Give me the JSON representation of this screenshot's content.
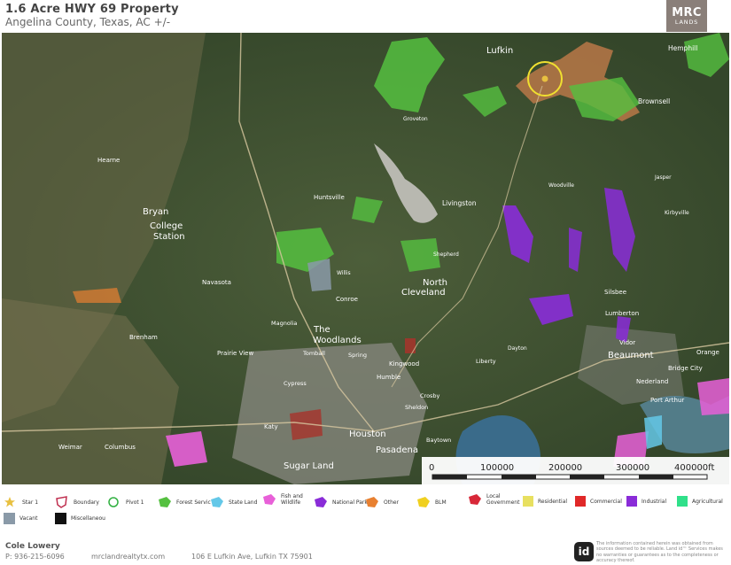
{
  "header": {
    "title": "1.6 Acre HWY 69 Property",
    "subtitle": "Angelina County, Texas,  AC +/-",
    "logo_line1": "MRC",
    "logo_line2": "LANDS"
  },
  "map": {
    "city_labels": [
      {
        "text": "Lufkin"
      },
      {
        "text": "Hemphill"
      },
      {
        "text": "Brownsell"
      },
      {
        "text": "Bryan"
      },
      {
        "text": "College"
      },
      {
        "text": "Station"
      },
      {
        "text": "Huntsville"
      },
      {
        "text": "Livingston"
      },
      {
        "text": "North"
      },
      {
        "text": "Cleveland"
      },
      {
        "text": "Navasota"
      },
      {
        "text": "Conroe"
      },
      {
        "text": "The"
      },
      {
        "text": "Woodlands"
      },
      {
        "text": "Beaumont"
      },
      {
        "text": "Lumberton"
      },
      {
        "text": "Silsbee"
      },
      {
        "text": "Brenham"
      },
      {
        "text": "Houston"
      },
      {
        "text": "Pasadena"
      },
      {
        "text": "Sugar Land"
      },
      {
        "text": "Katy"
      },
      {
        "text": "Humble"
      },
      {
        "text": "Kingwood"
      },
      {
        "text": "Orange"
      },
      {
        "text": "Port Arthur"
      },
      {
        "text": "Bridge City"
      },
      {
        "text": "Nederland"
      },
      {
        "text": "Vidor"
      },
      {
        "text": "Hearne"
      },
      {
        "text": "Prairie View"
      },
      {
        "text": "Tomball"
      },
      {
        "text": "Spring"
      },
      {
        "text": "Cypress"
      },
      {
        "text": "Baytown"
      },
      {
        "text": "Crosby"
      },
      {
        "text": "Weimar"
      },
      {
        "text": "Columbus"
      },
      {
        "text": "Liberty"
      },
      {
        "text": "Dayton"
      },
      {
        "text": "Magnolia"
      },
      {
        "text": "Sheldon"
      },
      {
        "text": "Willis"
      },
      {
        "text": "Shepherd"
      },
      {
        "text": "Groveton"
      },
      {
        "text": "Woodville"
      },
      {
        "text": "Jasper"
      },
      {
        "text": "Kirbyville"
      }
    ],
    "scale": {
      "labels": [
        "0",
        "100000",
        "200000",
        "300000",
        "400000ft"
      ]
    },
    "colors": {
      "forest_service": "#55c040",
      "state_land": "#64c8e8",
      "fish_wildlife": "#e860d8",
      "national_park": "#8a2cd8",
      "other": "#e88030",
      "local_government": "#d82838",
      "residential": "#e8e060",
      "commercial": "#e02828",
      "industrial": "#8a2cd8",
      "agricultural": "#30e08a",
      "vacant": "#8a9aa8",
      "miscellaneous": "#111111",
      "pivot": "#f0e030",
      "star": "#e8c040"
    }
  },
  "legend": {
    "items": [
      {
        "label": "Star 1",
        "icon": "star-icon"
      },
      {
        "label": "Boundary",
        "icon": "boundary-icon"
      },
      {
        "label": "Pivot 1",
        "icon": "pivot-circle-icon"
      },
      {
        "label": "Forest Servic",
        "icon": "forest-service-swatch"
      },
      {
        "label": "State Land",
        "icon": "state-land-swatch"
      },
      {
        "label": "Fish and Wildlife",
        "icon": "fish-wildlife-swatch"
      },
      {
        "label": "National Park",
        "icon": "national-park-swatch"
      },
      {
        "label": "Other",
        "icon": "other-swatch"
      },
      {
        "label": "BLM",
        "icon": "blm-swatch"
      },
      {
        "label": "Local Government",
        "icon": "local-government-swatch"
      },
      {
        "label": "Residential",
        "icon": "residential-swatch"
      },
      {
        "label": "Commercial",
        "icon": "commercial-swatch"
      },
      {
        "label": "Industrial",
        "icon": "industrial-swatch"
      },
      {
        "label": "Agricultural",
        "icon": "agricultural-swatch"
      },
      {
        "label": "Vacant",
        "icon": "vacant-swatch"
      },
      {
        "label": "Miscellaneou",
        "icon": "miscellaneous-swatch"
      }
    ]
  },
  "footer": {
    "agent_name": "Cole Lowery",
    "phone": "P: 936-215-6096",
    "website": "mrclandrealtytx.com",
    "address": "106 E Lufkin Ave, Lufkin TX 75901",
    "badge": "id",
    "disclaimer": "The information contained herein was obtained from sources deemed to be reliable. Land id™ Services makes no warranties or guarantees as to the completeness or accuracy thereof."
  }
}
